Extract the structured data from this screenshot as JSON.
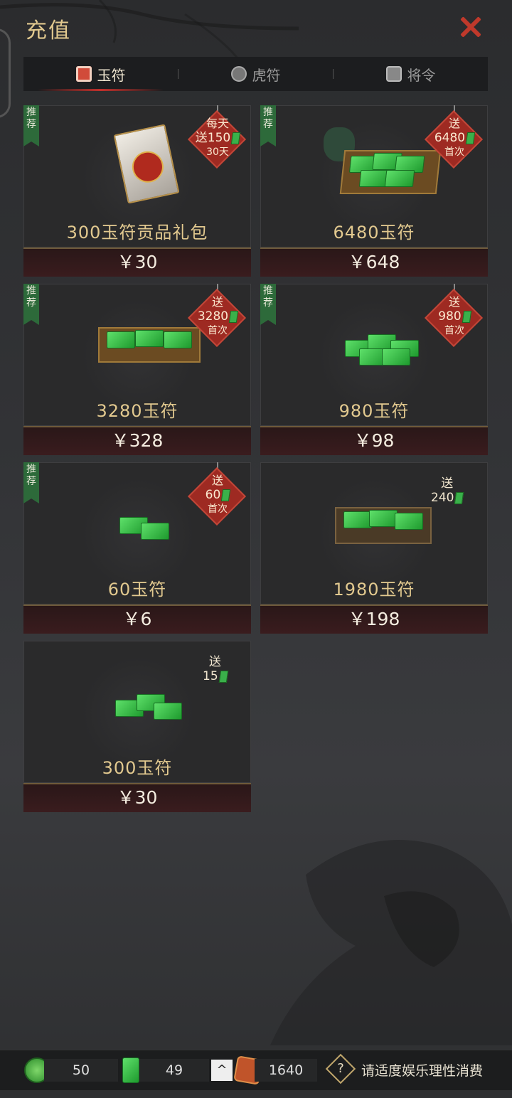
{
  "header": {
    "title": "充值",
    "close_icon": "close-icon"
  },
  "tabs": [
    {
      "label": "玉符",
      "icon": "jade-token-icon",
      "active": true
    },
    {
      "label": "虎符",
      "icon": "tiger-token-icon",
      "active": false
    },
    {
      "label": "将令",
      "icon": "general-order-icon",
      "active": false
    }
  ],
  "products": [
    {
      "name": "300玉符贡品礼包",
      "price": "￥30",
      "recommended": true,
      "rec_label": "推荐",
      "badge": {
        "type": "diamond",
        "line1": "每天",
        "line2": "送150",
        "line3": "30天"
      }
    },
    {
      "name": "6480玉符",
      "price": "￥648",
      "recommended": true,
      "rec_label": "推荐",
      "badge": {
        "type": "diamond",
        "line1": "送",
        "line2": "6480",
        "line3": "首次"
      }
    },
    {
      "name": "3280玉符",
      "price": "￥328",
      "recommended": true,
      "rec_label": "推荐",
      "badge": {
        "type": "diamond",
        "line1": "送",
        "line2": "3280",
        "line3": "首次"
      }
    },
    {
      "name": "980玉符",
      "price": "￥98",
      "recommended": true,
      "rec_label": "推荐",
      "badge": {
        "type": "diamond",
        "line1": "送",
        "line2": "980",
        "line3": "首次"
      }
    },
    {
      "name": "60玉符",
      "price": "￥6",
      "recommended": true,
      "rec_label": "推荐",
      "badge": {
        "type": "diamond",
        "line1": "送",
        "line2": "60",
        "line3": "首次"
      }
    },
    {
      "name": "1980玉符",
      "price": "￥198",
      "recommended": false,
      "badge": {
        "type": "plain",
        "line1": "送",
        "line2": "240"
      }
    },
    {
      "name": "300玉符",
      "price": "￥30",
      "recommended": false,
      "badge": {
        "type": "plain",
        "line1": "送",
        "line2": "15"
      }
    }
  ],
  "footer": {
    "currency1": {
      "icon": "green-coin-icon",
      "value": "50"
    },
    "currency2": {
      "icon": "jade-token-icon",
      "value": "49"
    },
    "expand_label": "^",
    "currency3": {
      "icon": "general-order-icon",
      "value": "1640"
    },
    "help_icon": "?",
    "notice": "请适度娱乐理性消费"
  },
  "colors": {
    "accent": "#c0392b",
    "gold": "#e2c98f",
    "jade": "#3ab04a",
    "recommend": "#2d6a3a"
  }
}
